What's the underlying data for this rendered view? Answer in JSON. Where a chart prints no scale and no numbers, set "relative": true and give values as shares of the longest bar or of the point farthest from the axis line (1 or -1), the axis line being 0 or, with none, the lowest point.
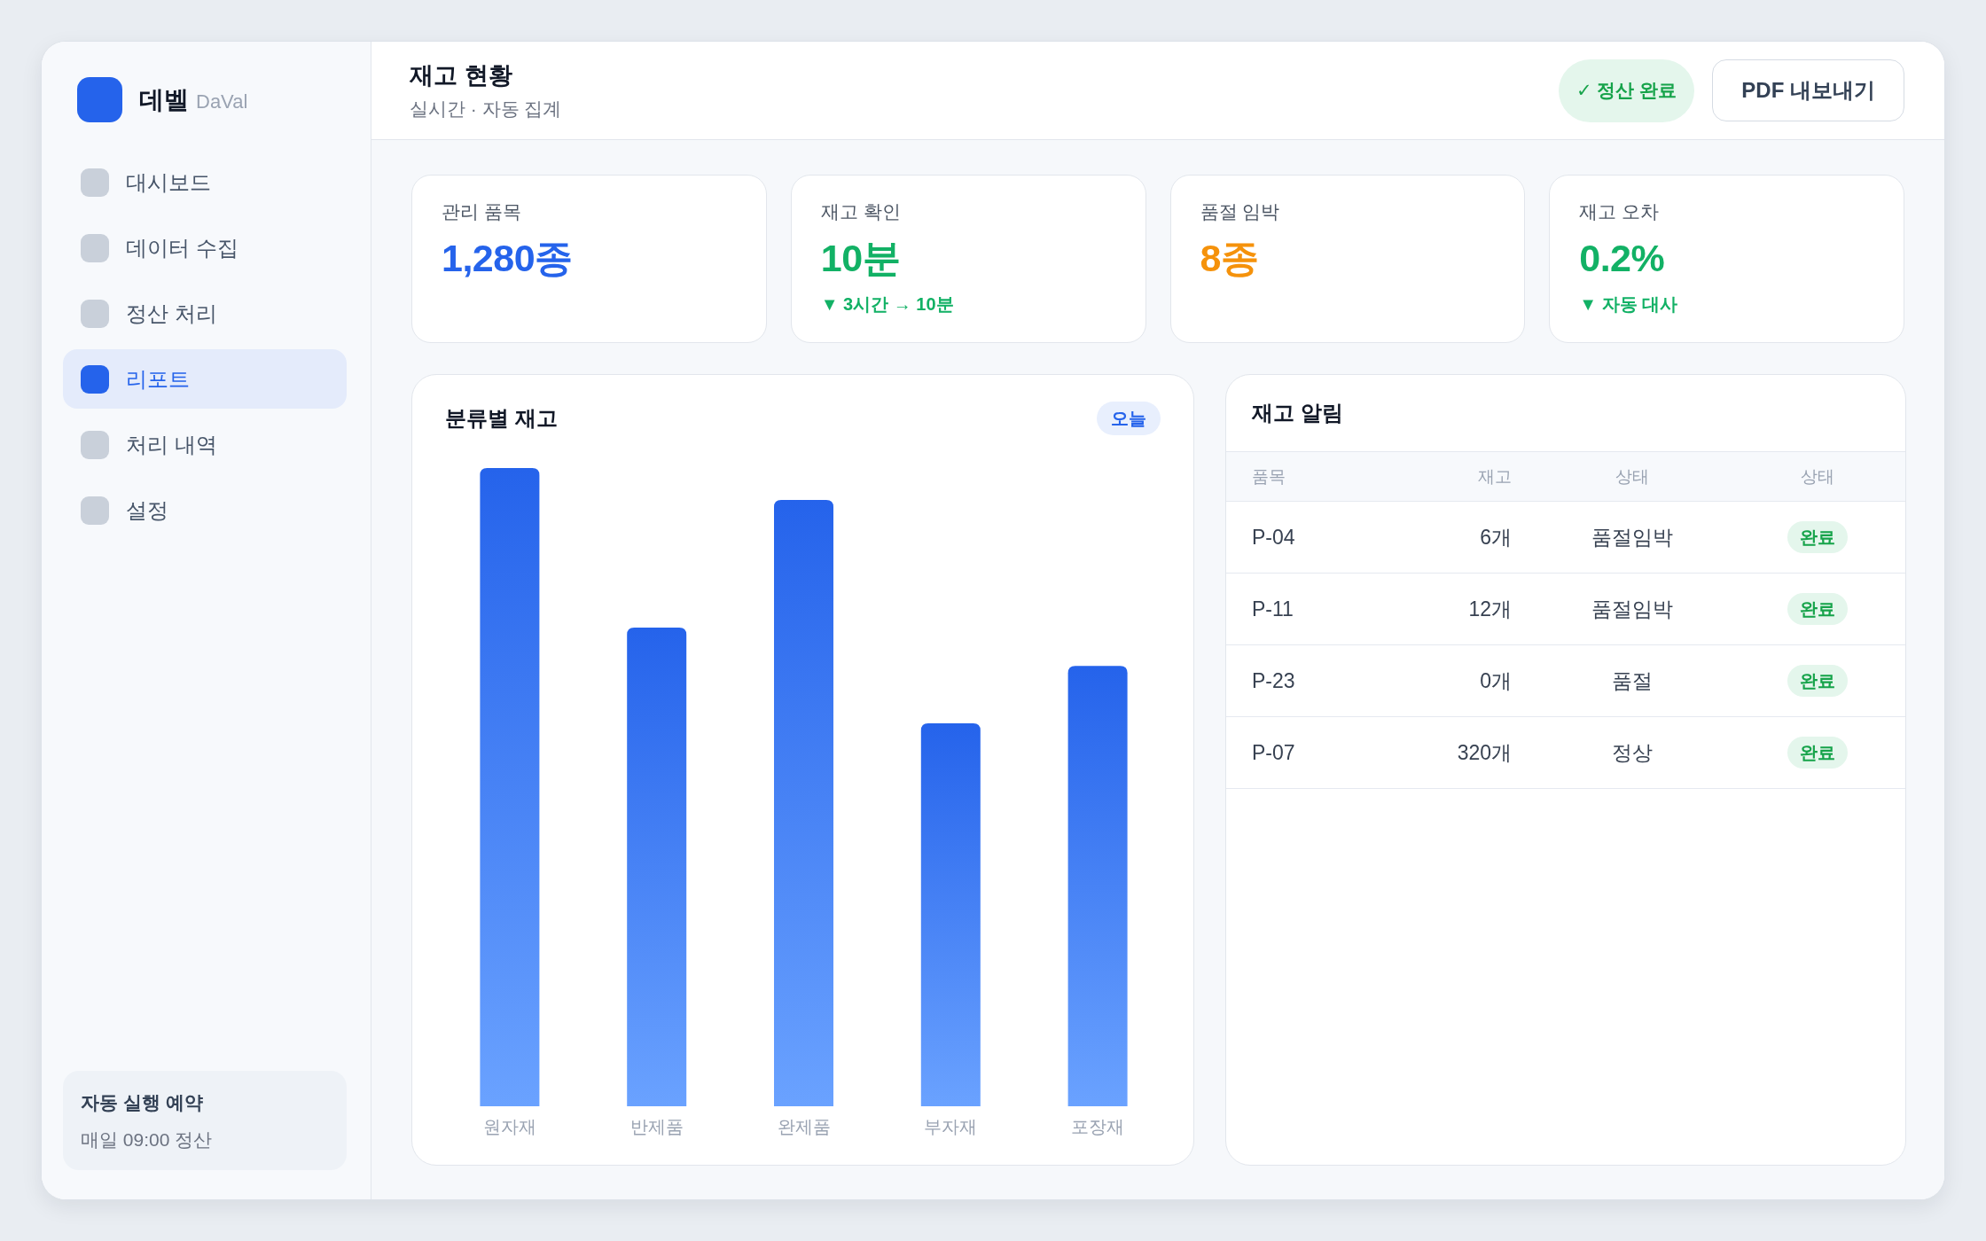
{
  "sidebar": {
    "brand": {
      "name": "데벨",
      "sub": "DaVal"
    },
    "items": [
      {
        "label": "대시보드",
        "selected": false
      },
      {
        "label": "데이터 수집",
        "selected": false
      },
      {
        "label": "정산 처리",
        "selected": false
      },
      {
        "label": "리포트",
        "selected": true
      },
      {
        "label": "처리 내역",
        "selected": false
      },
      {
        "label": "설정",
        "selected": false
      }
    ],
    "schedule": {
      "title": "자동 실행 예약",
      "detail": "매일 09:00 정산"
    }
  },
  "header": {
    "title": "재고 현황",
    "subtitle": "실시간 · 자동 집계",
    "status": "✓ 정산 완료",
    "export_button": "PDF 내보내기"
  },
  "kpis": [
    {
      "label": "관리 품목",
      "value": "1,280종",
      "color": "#2563eb"
    },
    {
      "label": "재고 확인",
      "value": "10분",
      "color": "#12b165",
      "note": "▼ 3시간 → 10분"
    },
    {
      "label": "품절 임박",
      "value": "8종",
      "color": "#f5920b"
    },
    {
      "label": "재고 오차",
      "value": "0.2%",
      "color": "#12b165",
      "note": "▼ 자동 대사"
    }
  ],
  "chart_panel": {
    "badge": "오늘",
    "chart_data": {
      "type": "bar",
      "title": "분류별 재고",
      "relative": true,
      "categories": [
        "원자재",
        "반제품",
        "완제품",
        "부자재",
        "포장재"
      ],
      "values": [
        1,
        0.75,
        0.95,
        0.6,
        0.69
      ]
    }
  },
  "alerts": {
    "title": "재고 알림",
    "columns": [
      "품목",
      "재고",
      "상태",
      "상태"
    ],
    "rows": [
      {
        "item": "P-04",
        "stock": "6개",
        "status": "품절임박",
        "badge": "완료"
      },
      {
        "item": "P-11",
        "stock": "12개",
        "status": "품절임박",
        "badge": "완료"
      },
      {
        "item": "P-23",
        "stock": "0개",
        "status": "품절",
        "badge": "완료"
      },
      {
        "item": "P-07",
        "stock": "320개",
        "status": "정상",
        "badge": "완료"
      }
    ]
  }
}
